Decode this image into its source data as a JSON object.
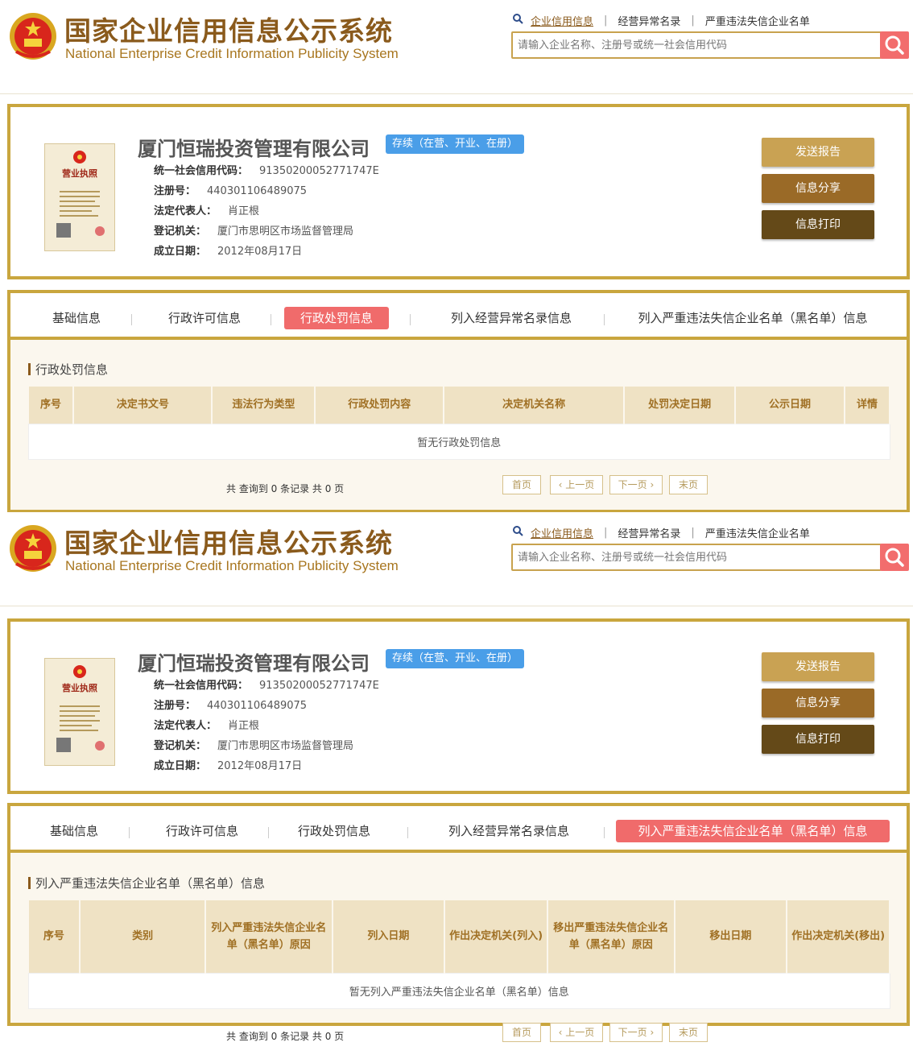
{
  "system": {
    "title": "国家企业信用信息公示系统",
    "subtitle": "National Enterprise Credit Information Publicity System"
  },
  "nav": {
    "links": [
      "企业信用信息",
      "经营异常名录",
      "严重违法失信企业名单"
    ]
  },
  "search": {
    "placeholder": "请输入企业名称、注册号或统一社会信用代码"
  },
  "company": {
    "name": "厦门恒瑞投资管理有限公司",
    "status": "存续（在营、开业、在册）",
    "fields": [
      {
        "label": "统一社会信用代码：",
        "value": "91350200052771747E"
      },
      {
        "label": "注册号：",
        "value": "440301106489075"
      },
      {
        "label": "法定代表人：",
        "value": "肖正根"
      },
      {
        "label": "登记机关：",
        "value": "厦门市思明区市场监督管理局"
      },
      {
        "label": "成立日期：",
        "value": "2012年08月17日"
      }
    ],
    "license_label": "营业执照"
  },
  "actions": [
    "发送报告",
    "信息分享",
    "信息打印"
  ],
  "tabs": [
    "基础信息",
    "行政许可信息",
    "行政处罚信息",
    "列入经营异常名录信息",
    "列入严重违法失信企业名单（黑名单）信息"
  ],
  "screens": [
    {
      "active_tab": 2,
      "section_title": "行政处罚信息",
      "columns": [
        "序号",
        "决定书文号",
        "违法行为类型",
        "行政处罚内容",
        "决定机关名称",
        "处罚决定日期",
        "公示日期",
        "详情"
      ],
      "empty_text": "暂无行政处罚信息"
    },
    {
      "active_tab": 4,
      "section_title": "列入严重违法失信企业名单（黑名单）信息",
      "columns": [
        "序号",
        "类别",
        "列入严重违法失信企业名单（黑名单）原因",
        "列入日期",
        "作出决定机关(列入)",
        "移出严重违法失信企业名单（黑名单）原因",
        "移出日期",
        "作出决定机关(移出)"
      ],
      "empty_text": "暂无列入严重违法失信企业名单（黑名单）信息"
    }
  ],
  "pagination": {
    "summary": "共 查询到 0 条记录 共 0 页",
    "first": "首页",
    "prev": "上一页",
    "next": "下一页",
    "last": "末页"
  },
  "colors": {
    "gold_border": "#c9a63e",
    "brand_brown": "#8a5a1c",
    "active_tab": "#f06b6b",
    "status_blue": "#4a9ee8",
    "btn_report": "#c9a253",
    "btn_share": "#9a6a27",
    "btn_print": "#644918"
  }
}
